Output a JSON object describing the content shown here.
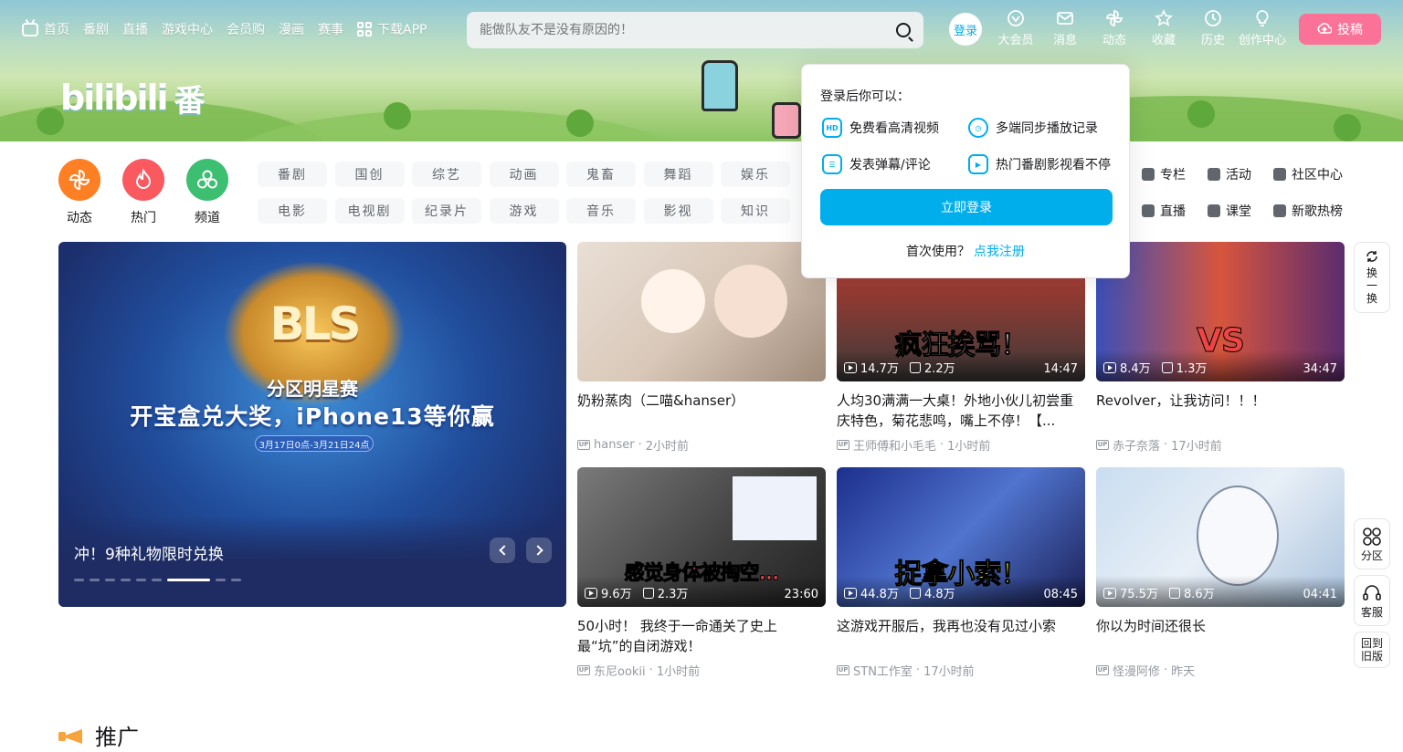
{
  "nav": {
    "items": [
      "首页",
      "番剧",
      "直播",
      "游戏中心",
      "会员购",
      "漫画",
      "赛事"
    ],
    "download": "下载APP"
  },
  "logo": {
    "text": "bilibili",
    "fan": "番"
  },
  "search": {
    "placeholder": "能做队友不是没有原因的！"
  },
  "header": {
    "login": "登录",
    "items": [
      "大会员",
      "消息",
      "动态",
      "收藏",
      "历史",
      "创作中心"
    ],
    "upload": "投稿"
  },
  "channels": {
    "circles": [
      {
        "label": "动态",
        "color": "#ff7f24"
      },
      {
        "label": "热门",
        "color": "#f9595f"
      },
      {
        "label": "频道",
        "color": "#3dbf72"
      }
    ],
    "row1": [
      "番剧",
      "国创",
      "综艺",
      "动画",
      "鬼畜",
      "舞蹈",
      "娱乐"
    ],
    "row2": [
      "电影",
      "电视剧",
      "纪录片",
      "游戏",
      "音乐",
      "影视",
      "知识"
    ],
    "extras": [
      "专栏",
      "活动",
      "社区中心",
      "直播",
      "课堂",
      "新歌热榜"
    ]
  },
  "carousel": {
    "badge": "BLS",
    "sub1": "分区明星赛",
    "sub2": "开宝盒兑大奖，iPhone13等你赢",
    "sub3": "3月17日0点-3月21日24点",
    "title": "冲！9种礼物限时兑换"
  },
  "videos": [
    {
      "title": "奶粉蒸肉（二喵&hanser）",
      "author": "hanser",
      "time": "2小时前",
      "plays": "",
      "likes": "",
      "duration": "",
      "caption": ""
    },
    {
      "title": "人均30满满一大桌！外地小伙儿初尝重庆特色，菊花悲鸣，嘴上不停！【...",
      "author": "王师傅和小毛毛",
      "time": "1小时前",
      "plays": "14.7万",
      "likes": "2.2万",
      "duration": "14:47",
      "caption": "疯狂挨骂！"
    },
    {
      "title": "Revolver，让我访问！！！",
      "author": "赤子奈落",
      "time": "17小时前",
      "plays": "8.4万",
      "likes": "1.3万",
      "duration": "34:47",
      "caption": "VS"
    },
    {
      "title": "50小时！ 我终于一命通关了史上最“坑”的自闭游戏！",
      "author": "东尼ookii",
      "time": "1小时前",
      "plays": "9.6万",
      "likes": "2.3万",
      "duration": "23:60",
      "caption": "感觉身体被掏空..."
    },
    {
      "title": "这游戏开服后，我再也没有见过小索",
      "author": "STN工作室",
      "time": "17小时前",
      "plays": "44.8万",
      "likes": "4.8万",
      "duration": "08:45",
      "caption": "捉拿小索！"
    },
    {
      "title": "你以为时间还很长",
      "author": "怪漫阿修",
      "time": "昨天",
      "plays": "75.5万",
      "likes": "8.6万",
      "duration": "04:41",
      "caption": ""
    }
  ],
  "floating": {
    "refresh": "换一换",
    "section": "分区",
    "service": "客服",
    "old": "回到旧版"
  },
  "login_popup": {
    "heading": "登录后你可以：",
    "perks": [
      "免费看高清视频",
      "多端同步播放记录",
      "发表弹幕/评论",
      "热门番剧影视看不停"
    ],
    "button": "立即登录",
    "first_use": "首次使用？",
    "register": "点我注册"
  },
  "promo": {
    "title": "推广"
  },
  "colors": {
    "brand_blue": "#00aeec",
    "brand_pink": "#fb7299"
  }
}
